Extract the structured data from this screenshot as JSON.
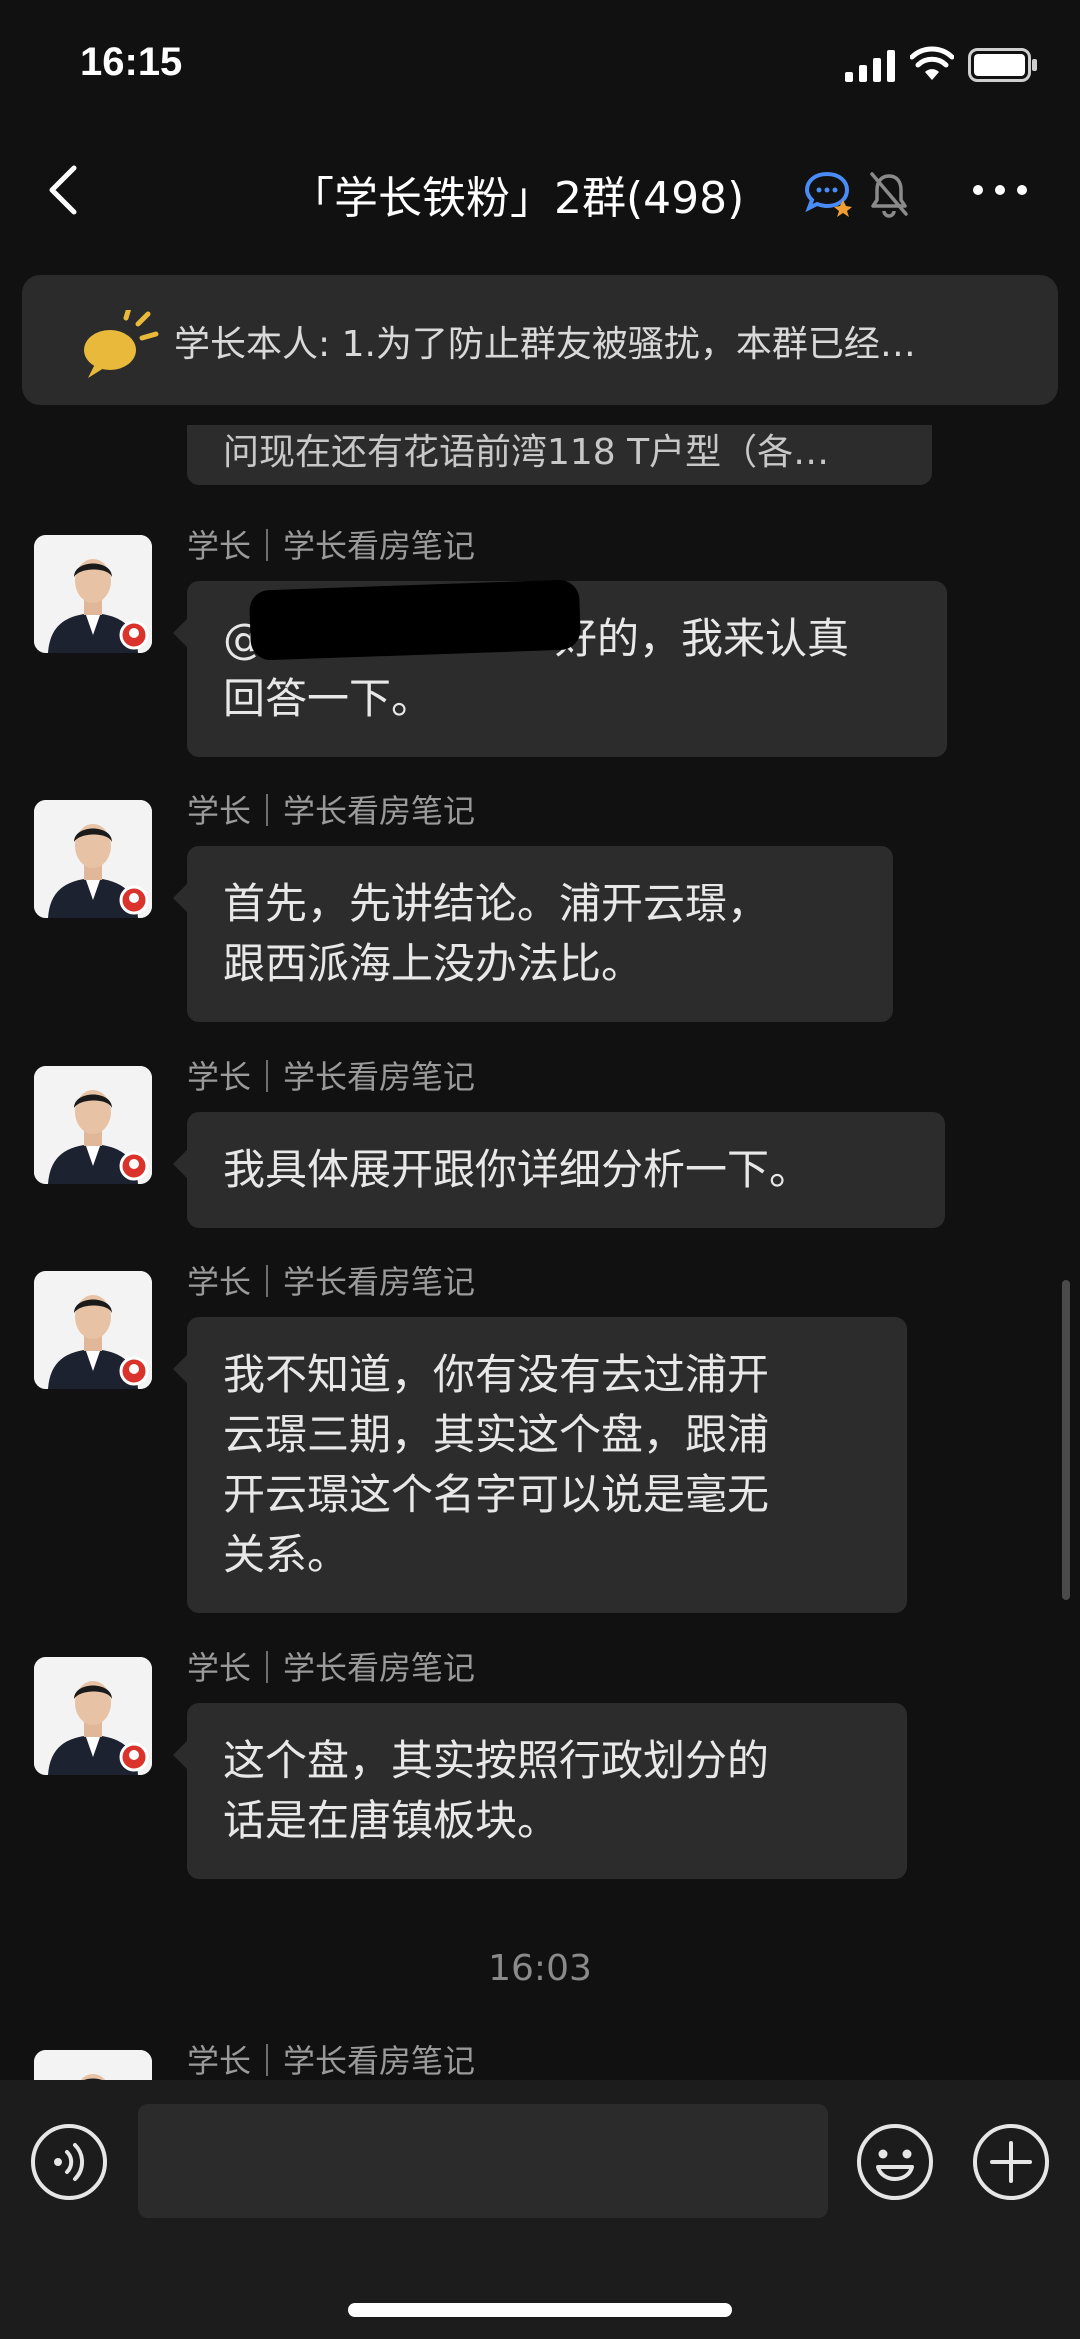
{
  "status_bar": {
    "time": "16:15"
  },
  "nav": {
    "title": "「学长铁粉」2群(498)",
    "back_icon": "chevron-left-icon",
    "more_icon": "more-dots-icon"
  },
  "notice": {
    "text": "学长本人: 1.为了防止群友被骚扰，本群已经…",
    "icon": "megaphone-icon"
  },
  "partial_message": {
    "text": "问现在还有花语前湾118 T户型（各…"
  },
  "messages": [
    {
      "sender": "学长｜学长看房笔记",
      "lines": [
        "@",
        "好的，我来认真",
        "回答一下。"
      ]
    },
    {
      "sender": "学长｜学长看房笔记",
      "lines": [
        "首先，先讲结论。浦开云璟，",
        "跟西派海上没办法比。"
      ]
    },
    {
      "sender": "学长｜学长看房笔记",
      "lines": [
        "我具体展开跟你详细分析一下。"
      ]
    },
    {
      "sender": "学长｜学长看房笔记",
      "lines": [
        "我不知道，你有没有去过浦开",
        "云璟三期，其实这个盘，跟浦",
        "开云璟这个名字可以说是毫无",
        "关系。"
      ]
    },
    {
      "sender": "学长｜学长看房笔记",
      "lines": [
        "这个盘，其实按照行政划分的",
        "话是在唐镇板块。"
      ]
    },
    {
      "sender": "学长｜学长看房笔记"
    }
  ],
  "timestamp": "16:03",
  "input": {
    "placeholder": ""
  },
  "colors": {
    "background": "#111111",
    "bubble": "#2c2c2c",
    "accent_blue": "#4a8cf7",
    "notice_yellow": "#e8b93a"
  }
}
